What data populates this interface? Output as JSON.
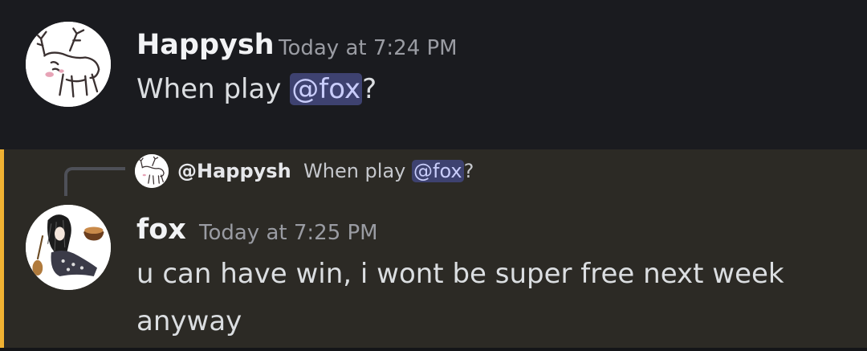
{
  "messages": [
    {
      "avatar": "reindeer-doodle-avatar",
      "username": "Happysh",
      "timestamp": "Today at 7:24 PM",
      "content_before": "When play ",
      "mention": "@fox",
      "content_after": "?"
    },
    {
      "avatar": "anime-character-avatar",
      "reply": {
        "avatar": "reindeer-doodle-avatar",
        "user": "@Happysh",
        "text_before": "When play ",
        "mention": "@fox",
        "text_after": "?"
      },
      "username": "fox",
      "timestamp": "Today at 7:25 PM",
      "content_line1": "u can have win, i wont be super free next week",
      "content_line2": "anyway"
    }
  ],
  "colors": {
    "background": "#1a1b1f",
    "highlight_background": "#2c2a25",
    "mention_bar": "#f0b232",
    "mention_background": "#3e4270",
    "mention_text": "#c9cdfb"
  }
}
